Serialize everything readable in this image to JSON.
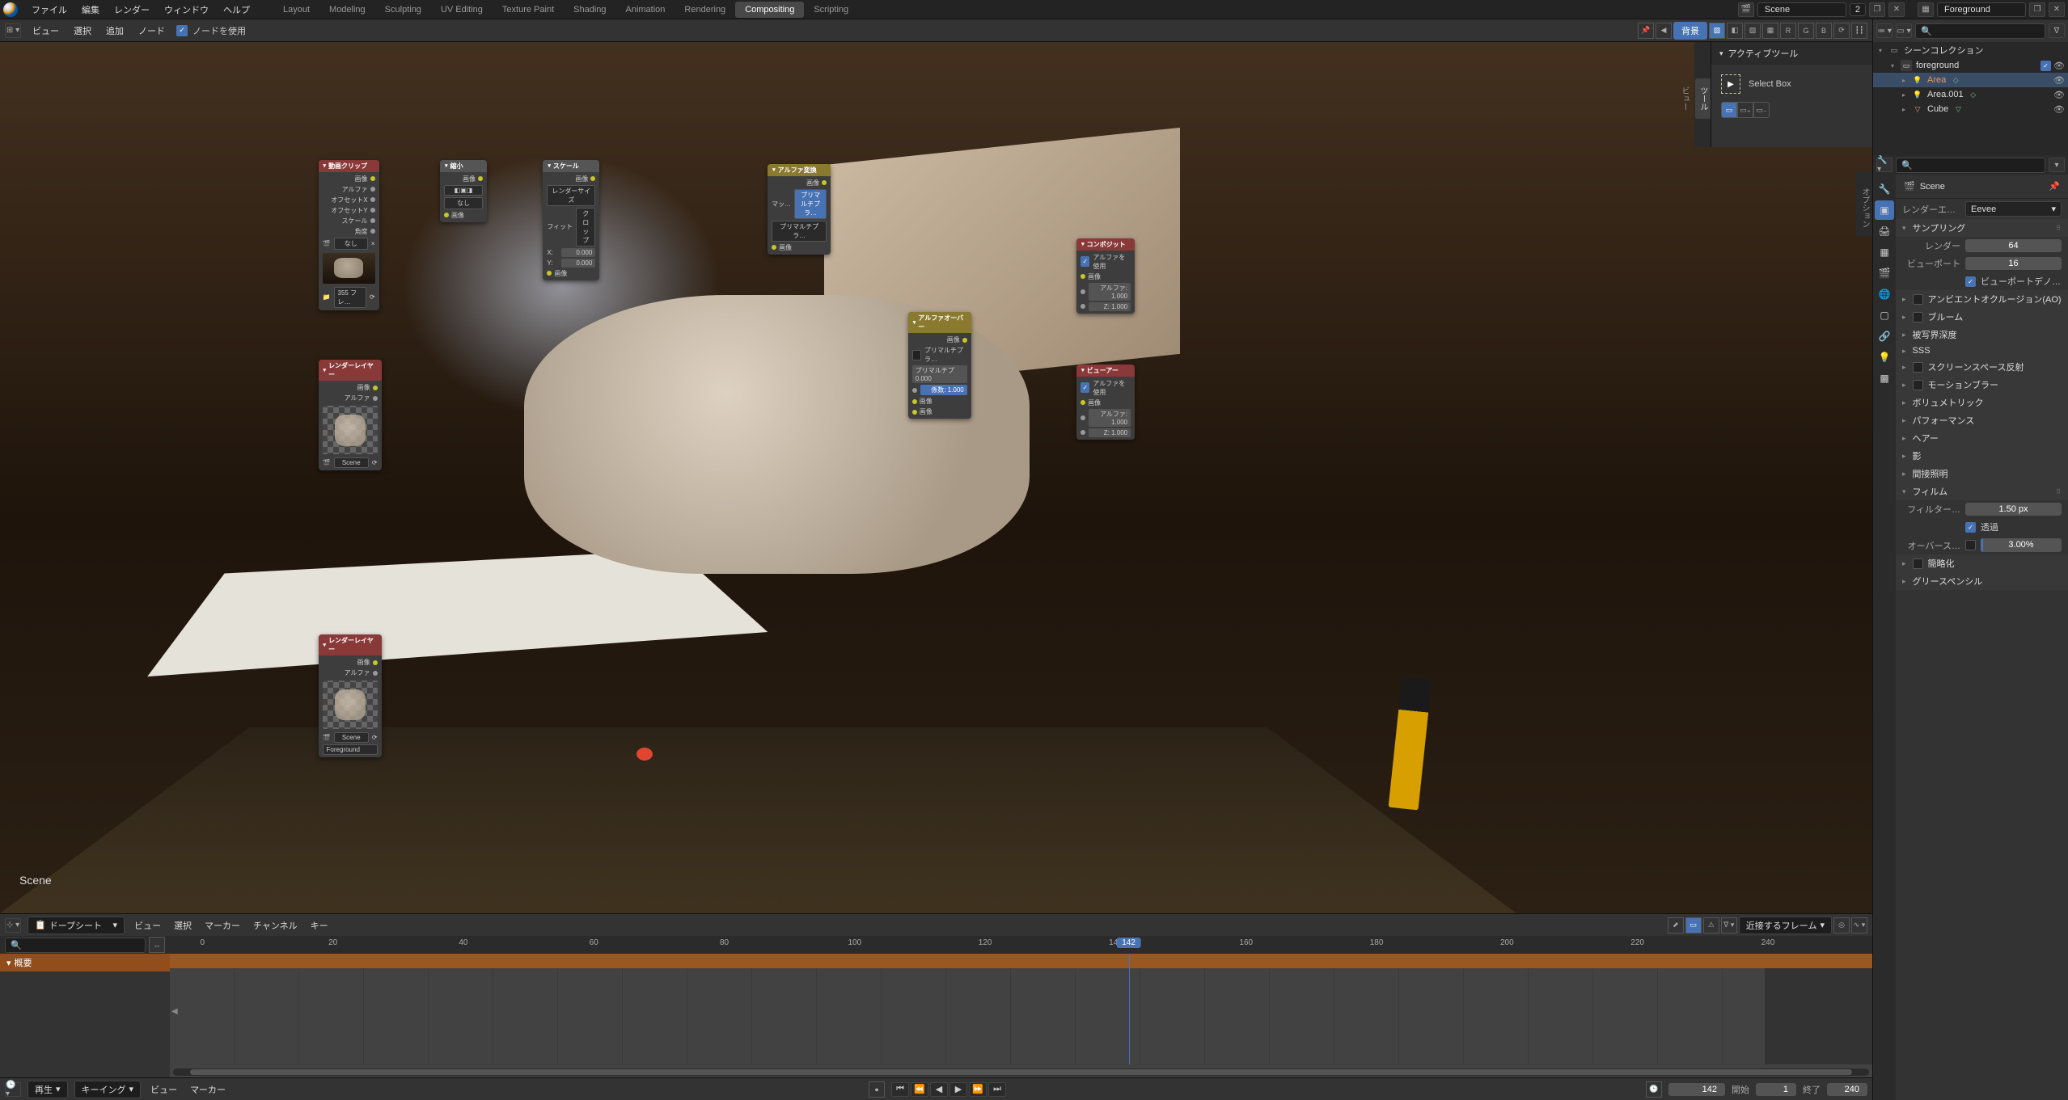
{
  "top": {
    "menus": [
      "ファイル",
      "編集",
      "レンダー",
      "ウィンドウ",
      "ヘルプ"
    ],
    "workspaces": [
      "Layout",
      "Modeling",
      "Sculpting",
      "UV Editing",
      "Texture Paint",
      "Shading",
      "Animation",
      "Rendering",
      "Compositing",
      "Scripting"
    ],
    "active_workspace": "Compositing",
    "scene": "Scene",
    "scene_users": "2",
    "view_layer": "Foreground"
  },
  "compositor": {
    "header": {
      "menus": [
        "ビュー",
        "選択",
        "追加",
        "ノード"
      ],
      "use_nodes_label": "ノードを使用",
      "backdrop_btn": "背景",
      "rgba": [
        "R",
        "G",
        "B"
      ]
    },
    "scene_overlay": "Scene",
    "tool_panel": {
      "title": "アクティブツール",
      "tool_name": "Select Box",
      "side_tabs": [
        "ツール",
        "ビュー"
      ],
      "opts_tab": "オプション"
    },
    "nodes": {
      "movieclip": {
        "title": "動画クリップ",
        "out1": "画像",
        "out2": "アルファ",
        "out3": "オフセットX",
        "out4": "オフセットY",
        "out5": "スケール",
        "out6": "角度",
        "source": "なし",
        "frames": "355 フレ…"
      },
      "scale": {
        "title": "縮小",
        "out": "画像"
      },
      "scale2": {
        "title": "スケール",
        "out": "画像",
        "mode": "レンダーサイズ",
        "fit_lbl": "フィット",
        "fit_val": "クロップ",
        "in": "画像",
        "x_lbl": "X:",
        "x_val": "0.000",
        "y_lbl": "Y:",
        "y_val": "0.000"
      },
      "alphaconv": {
        "title": "アルファ変換",
        "out": "画像",
        "mode_lbl": "マッ…",
        "mode_l": "プリマルチプラ…",
        "mode_r": "プリマルチプラ…",
        "in": "画像"
      },
      "renderlayers1": {
        "title": "レンダーレイヤー",
        "out1": "画像",
        "out2": "アルファ",
        "scene": "Scene"
      },
      "renderlayers2": {
        "title": "レンダーレイヤー",
        "out1": "画像",
        "out2": "アルファ",
        "scene": "Scene",
        "layer": "Foreground"
      },
      "alphaover": {
        "title": "アルファオーバー",
        "out": "画像",
        "premul_lbl": "プリマルチプラ…",
        "premul_val": "プリマルチプ 0.000",
        "fac_lbl": "係数:",
        "fac_val": "1.000",
        "in1": "画像",
        "in2": "画像"
      },
      "composite": {
        "title": "コンポジット",
        "use_alpha": "アルファを使用",
        "in1": "画像",
        "alpha_lbl": "アルファ:",
        "alpha_val": "1.000",
        "z_lbl": "Z:",
        "z_val": "1.000"
      },
      "viewer": {
        "title": "ビューアー",
        "use_alpha": "アルファを使用",
        "in1": "画像",
        "alpha_lbl": "アルファ:",
        "alpha_val": "1.000",
        "z_lbl": "Z:",
        "z_val": "1.000"
      }
    }
  },
  "timeline": {
    "mode": "ドープシート",
    "menus": [
      "ビュー",
      "選択",
      "マーカー",
      "チャンネル",
      "キー"
    ],
    "snap": "近接するフレーム",
    "summary_label": "概要",
    "ticks": [
      0,
      20,
      40,
      60,
      80,
      100,
      120,
      140,
      160,
      180,
      200,
      220,
      240
    ],
    "current_frame": "142",
    "footer_menus": [
      "再生",
      "キーイング",
      "ビュー",
      "マーカー"
    ],
    "frame_field": "142",
    "start_label": "開始",
    "start_val": "1",
    "end_label": "終了",
    "end_val": "240"
  },
  "outliner": {
    "root": "シーンコレクション",
    "items": [
      {
        "name": "foreground",
        "type": "collection"
      },
      {
        "name": "Area",
        "type": "light",
        "selected": true
      },
      {
        "name": "Area.001",
        "type": "light"
      },
      {
        "name": "Cube",
        "type": "mesh"
      }
    ]
  },
  "properties": {
    "context_title": "Scene",
    "render_engine_label": "レンダーエン…",
    "render_engine": "Eevee",
    "sampling_header": "サンプリング",
    "render_label": "レンダー",
    "render_samples": "64",
    "viewport_label": "ビューポート",
    "viewport_samples": "16",
    "viewport_denoise": "ビューポートデノ…",
    "panels": [
      "アンビエントオクルージョン(AO)",
      "ブルーム",
      "被写界深度",
      "SSS",
      "スクリーンスペース反射",
      "モーションブラー",
      "ボリュメトリック",
      "パフォーマンス",
      "ヘアー",
      "影",
      "間接照明"
    ],
    "film_header": "フィルム",
    "filter_label": "フィルター…",
    "filter_val": "1.50 px",
    "transparent_label": "透過",
    "overscan_label": "オーバース…",
    "overscan_val": "3.00%",
    "simplify_label": "簡略化",
    "gpencil_label": "グリースペンシル"
  }
}
